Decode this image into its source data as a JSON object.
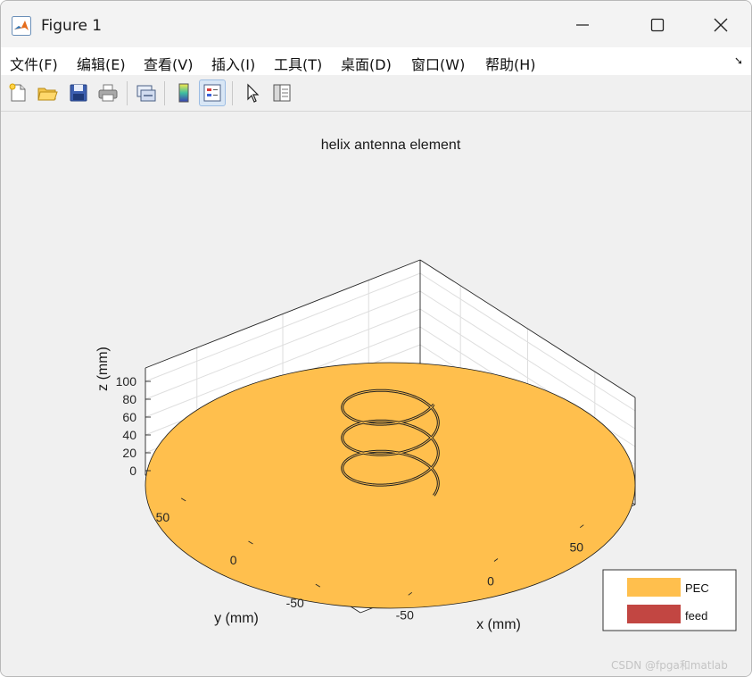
{
  "window": {
    "title": "Figure 1"
  },
  "menu": [
    {
      "label": "文件(F)"
    },
    {
      "label": "编辑(E)"
    },
    {
      "label": "查看(V)"
    },
    {
      "label": "插入(I)"
    },
    {
      "label": "工具(T)"
    },
    {
      "label": "桌面(D)"
    },
    {
      "label": "窗口(W)"
    },
    {
      "label": "帮助(H)"
    }
  ],
  "menu_overflow_icon": "dock-arrow-icon",
  "toolbar": [
    {
      "icon": "new-figure-icon"
    },
    {
      "icon": "open-file-icon"
    },
    {
      "icon": "save-icon"
    },
    {
      "icon": "print-icon"
    },
    {
      "icon": "link-plot-icon"
    },
    {
      "icon": "insert-colorbar-icon"
    },
    {
      "icon": "insert-legend-icon",
      "active": true
    },
    {
      "icon": "edit-plot-icon"
    },
    {
      "icon": "property-inspector-icon"
    }
  ],
  "colors": {
    "pec": "#ffbf4d",
    "feed": "#c24642",
    "helix": "#222222"
  },
  "chart_data": {
    "type": "3d-surface-line",
    "title": "helix antenna element",
    "xlabel": "x (mm)",
    "ylabel": "y (mm)",
    "zlabel": "z (mm)",
    "xlim": [
      -80,
      80
    ],
    "ylim": [
      -80,
      80
    ],
    "zlim": [
      -5,
      115
    ],
    "xticks": [
      "-50",
      "0",
      "50"
    ],
    "yticks": [
      "-50",
      "0",
      "50"
    ],
    "zticks": [
      "0",
      "20",
      "40",
      "60",
      "80",
      "100"
    ],
    "grid": true,
    "legend_position": "bottom-right",
    "legend": [
      "PEC",
      "feed"
    ],
    "ground_plane": {
      "shape": "disk",
      "radius": 80,
      "z": 0
    },
    "helix": {
      "radius": 22,
      "turns": 3,
      "z_start": 0,
      "z_end": 102
    }
  },
  "watermark": "CSDN @fpga和matlab"
}
